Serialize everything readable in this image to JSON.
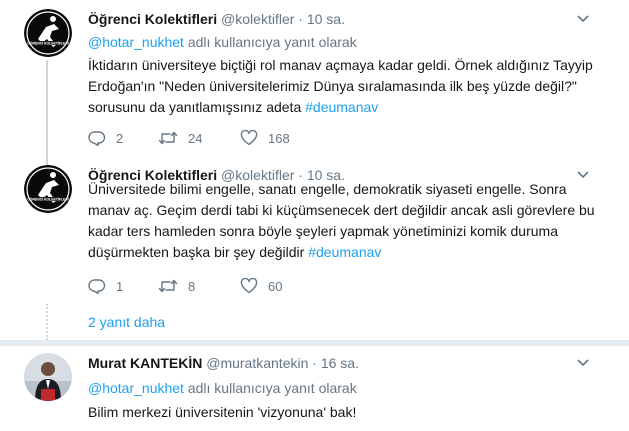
{
  "tweets": [
    {
      "name": "Öğrenci Kolektifleri",
      "handle": "@kolektifler",
      "dot": "·",
      "time": "10 sa.",
      "reply_mention": "@hotar_nukhet",
      "reply_suffix": "adlı kullanıcıya yanıt olarak",
      "text_lines": [
        "İktidarın üniversiteye biçtiği rol manav açmaya kadar geldi. Örnek aldığınız Tayyip",
        "Erdoğan'ın \"Neden üniversitelerimiz Dünya sıralamasında ilk beş yüzde değil?\"",
        "sorusunu da yanıtlamışsınız adeta"
      ],
      "hashtag": "#deumanav",
      "replies": "2",
      "retweets": "24",
      "likes": "168"
    },
    {
      "name": "Öğrenci Kolektifleri",
      "handle": "@kolektifler",
      "dot": "·",
      "time": "10 sa.",
      "text_lines": [
        "Üniversitede bilimi engelle, sanatı engelle, demokratik siyaseti engelle. Sonra",
        "manav aç. Geçim derdi tabi ki küçümsenecek dert değildir ancak asli görevlere bu",
        "kadar ters hamleden sonra böyle şeyleri yapmak yönetiminizi komik duruma",
        "düşürmekten başka bir şey değildir"
      ],
      "hashtag": "#deumanav",
      "replies": "1",
      "retweets": "8",
      "likes": "60"
    },
    {
      "name": "Murat KANTEKİN",
      "handle": "@muratkantekin",
      "dot": "·",
      "time": "16 sa.",
      "reply_mention": "@hotar_nukhet",
      "reply_suffix": "adlı kullanıcıya yanıt olarak",
      "text_lines": [
        "Bilim merkezi üniversitenin 'vizyonuna' bak!"
      ]
    }
  ],
  "more_replies": "2 yanıt daha",
  "colors": {
    "link": "#1da1f2",
    "muted": "#657786",
    "separator": "#e6ecf0",
    "thread_line": "#ccd6dd"
  },
  "icons": {
    "caret": "chevron-down-icon",
    "reply": "reply-icon",
    "retweet": "retweet-icon",
    "like": "heart-icon"
  }
}
